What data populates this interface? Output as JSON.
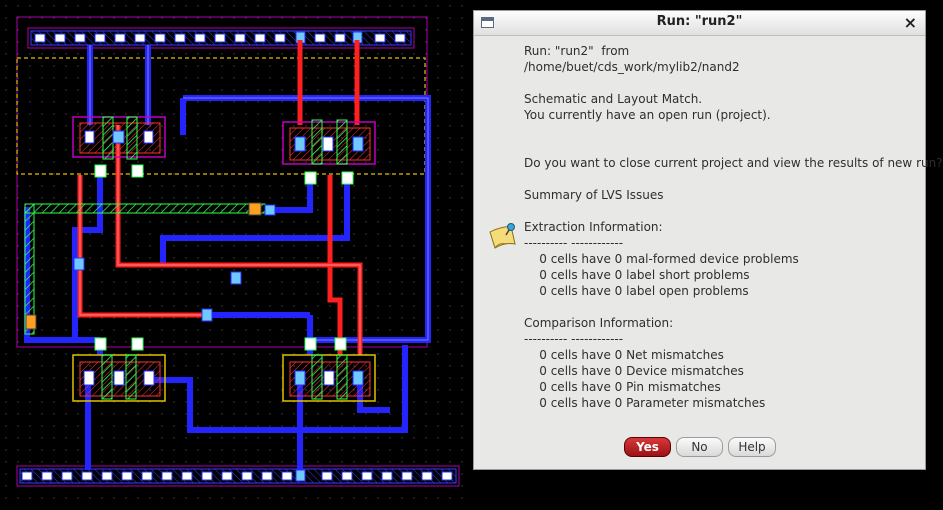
{
  "dialog": {
    "title": "Run: \"run2\"",
    "lines": [
      "Run: \"run2\"  from",
      "/home/buet/cds_work/mylib2/nand2",
      "",
      "Schematic and Layout Match.",
      "You currently have an open run (project).",
      "",
      "",
      "Do you want to close current project and view the results of new run?",
      "",
      "Summary of LVS Issues",
      "",
      "Extraction Information:",
      "---------- ------------",
      "    0 cells have 0 mal-formed device problems",
      "    0 cells have 0 label short problems",
      "    0 cells have 0 label open problems",
      "",
      "Comparison Information:",
      "---------- ------------",
      "    0 cells have 0 Net mismatches",
      "    0 cells have 0 Device mismatches",
      "    0 cells have 0 Pin mismatches",
      "    0 cells have 0 Parameter mismatches"
    ],
    "buttons": {
      "yes": "Yes",
      "no": "No",
      "help": "Help"
    },
    "icons": {
      "window": "window-icon",
      "close": "close-icon",
      "info": "info-note-icon"
    }
  },
  "layout": {
    "icon": "nand2-layout-view",
    "colors": {
      "background": "#000000",
      "metal1": "#2020ff",
      "poly": "#ff2020",
      "diffusion": "#20ff40",
      "nwell": "#ffd000",
      "boundary": "#c000c0",
      "contact": "#40c0ff",
      "via": "#ffa000"
    }
  }
}
